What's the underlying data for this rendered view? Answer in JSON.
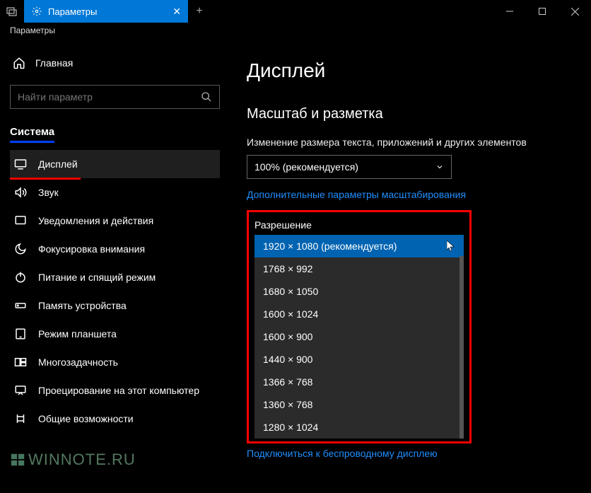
{
  "titlebar": {
    "tab_label": "Параметры",
    "app_label": "Параметры"
  },
  "sidebar": {
    "home": "Главная",
    "search_placeholder": "Найти параметр",
    "section": "Система",
    "items": [
      {
        "label": "Дисплей"
      },
      {
        "label": "Звук"
      },
      {
        "label": "Уведомления и действия"
      },
      {
        "label": "Фокусировка внимания"
      },
      {
        "label": "Питание и спящий режим"
      },
      {
        "label": "Память устройства"
      },
      {
        "label": "Режим планшета"
      },
      {
        "label": "Многозадачность"
      },
      {
        "label": "Проецирование на этот компьютер"
      },
      {
        "label": "Общие возможности"
      }
    ]
  },
  "content": {
    "title": "Дисплей",
    "scale_heading": "Масштаб и разметка",
    "scale_label": "Изменение размера текста, приложений и других элементов",
    "scale_value": "100% (рекомендуется)",
    "advanced_link": "Дополнительные параметры масштабирования",
    "resolution_label": "Разрешение",
    "resolutions": [
      "1920 × 1080 (рекомендуется)",
      "1768 × 992",
      "1680 × 1050",
      "1600 × 1024",
      "1600 × 900",
      "1440 × 900",
      "1366 × 768",
      "1360 × 768",
      "1280 × 1024"
    ],
    "wireless_link": "Подключиться к беспроводному дисплею"
  },
  "watermark": "WINNOTE.RU"
}
